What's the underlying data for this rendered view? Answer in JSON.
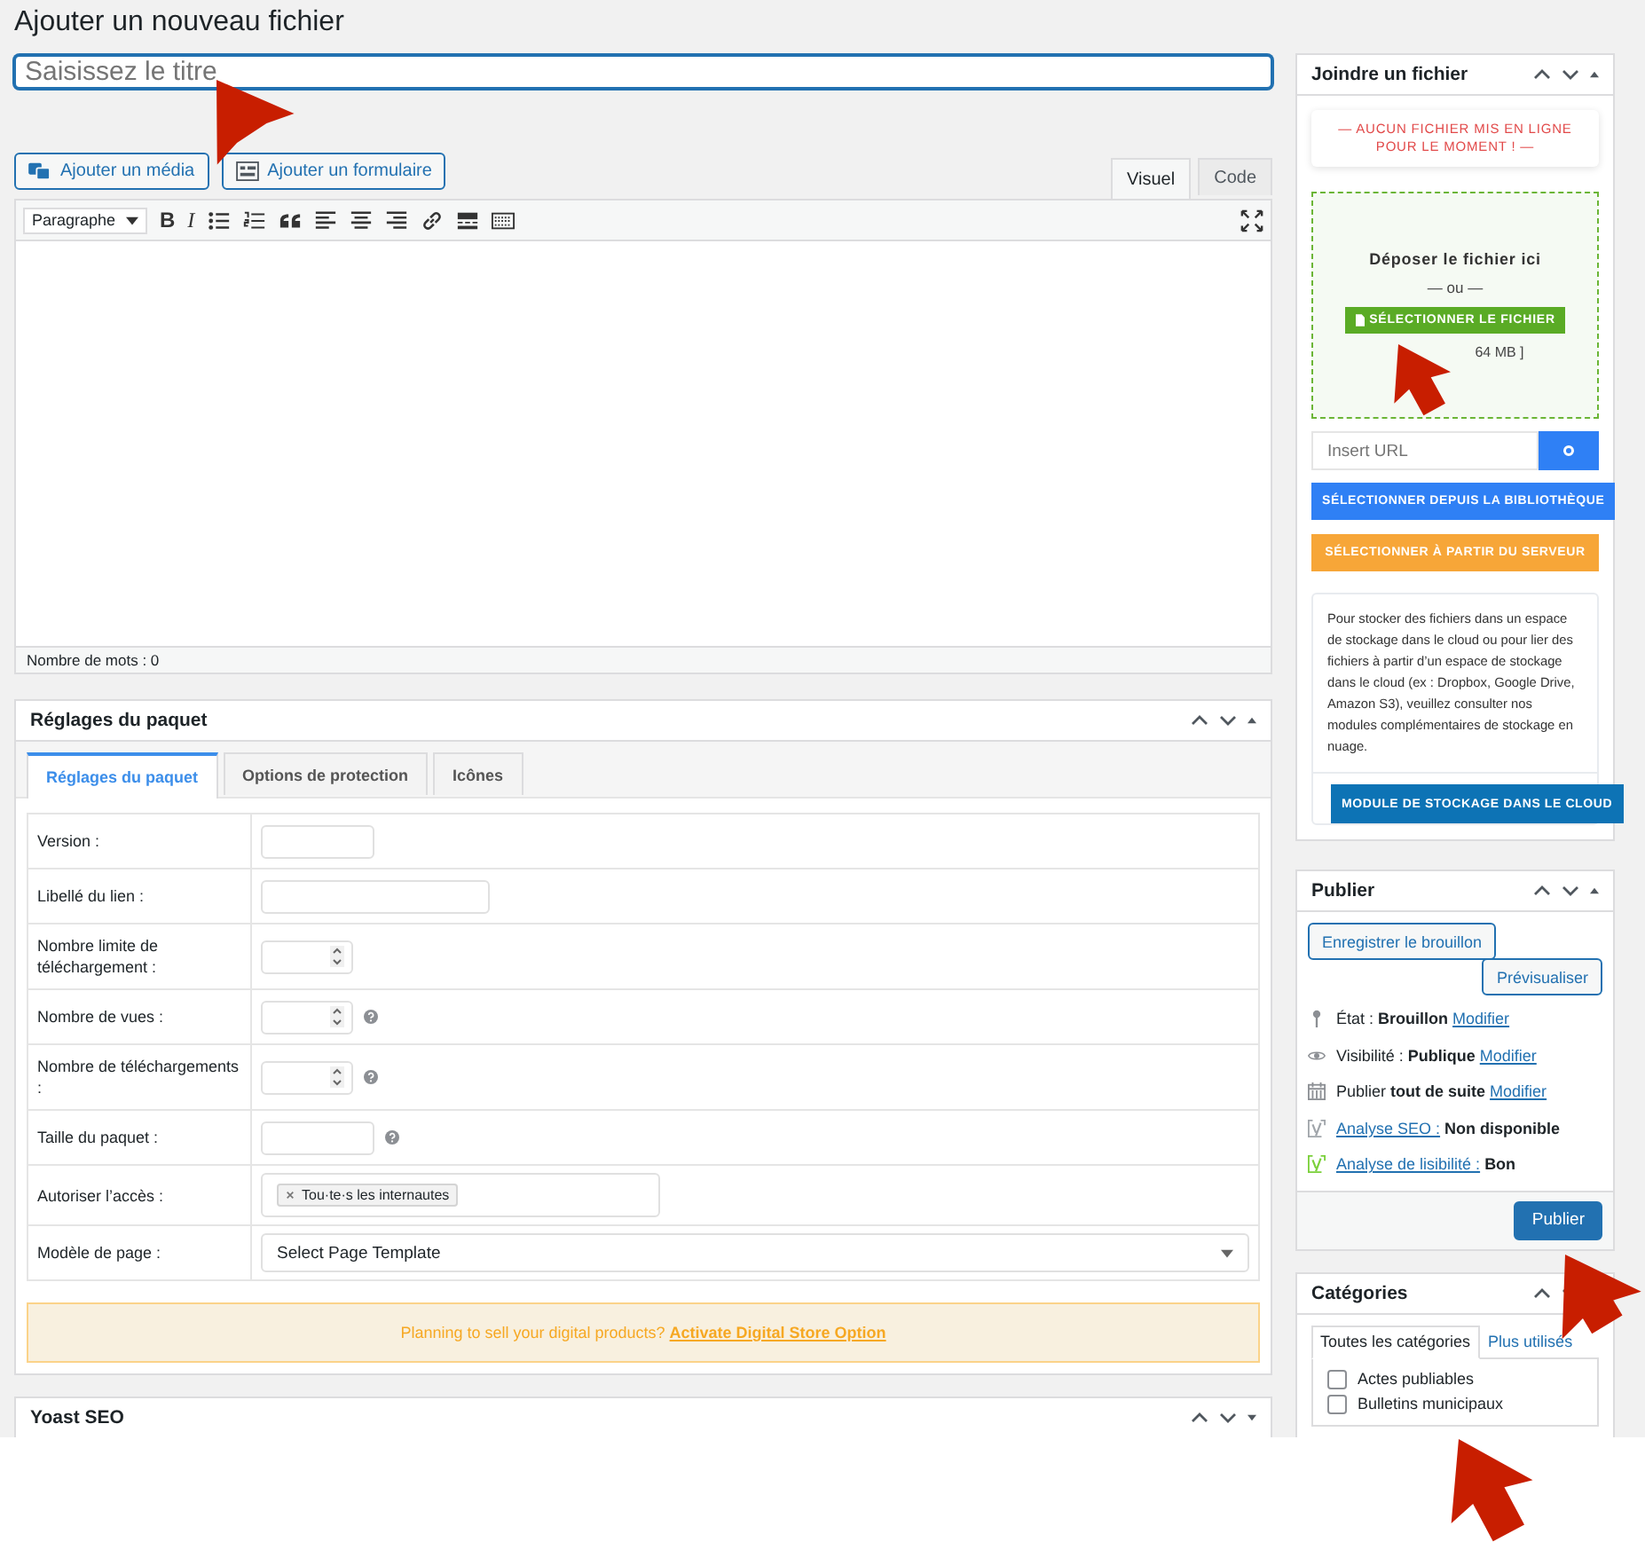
{
  "page_title": "Ajouter un nouveau fichier",
  "title_field": {
    "placeholder": "Saisissez le titre"
  },
  "media_buttons": [
    {
      "kind": "media",
      "label": "Ajouter un média"
    },
    {
      "kind": "form",
      "label": "Ajouter un formulaire"
    }
  ],
  "editor_tabs": [
    {
      "label": "Visuel",
      "selected": true
    },
    {
      "label": "Code",
      "selected": false
    }
  ],
  "format_select": "Paragraphe",
  "toolbar": [
    {
      "kind": "bold",
      "label": "B"
    },
    {
      "kind": "italic",
      "label": "I"
    },
    {
      "kind": "bullets"
    },
    {
      "kind": "numbers"
    },
    {
      "kind": "quote"
    },
    {
      "kind": "align-left"
    },
    {
      "kind": "align-center"
    },
    {
      "kind": "align-right"
    },
    {
      "kind": "link"
    },
    {
      "kind": "more"
    },
    {
      "kind": "toolbar"
    }
  ],
  "word_count": "Nombre de mots : 0",
  "package_settings": {
    "title": "Réglages du paquet",
    "tabs": [
      {
        "label": "Réglages du paquet",
        "selected": true
      },
      {
        "label": "Options de protection",
        "selected": false
      },
      {
        "label": "Icônes",
        "selected": false
      }
    ],
    "fields": [
      {
        "label": "Version :",
        "kind": "short"
      },
      {
        "label": "Libellé du lien :",
        "kind": "wide"
      },
      {
        "label": "Nombre limite de téléchargement :",
        "kind": "number"
      },
      {
        "label": "Nombre de vues :",
        "kind": "number",
        "help": true
      },
      {
        "label": "Nombre de téléchargements :",
        "kind": "number",
        "help": true
      },
      {
        "label": "Taille du paquet :",
        "kind": "short",
        "help": true
      },
      {
        "label": "Autoriser l’accès :",
        "kind": "tags",
        "tags": [
          "Tou·te·s les internautes"
        ]
      },
      {
        "label": "Modèle de page :",
        "kind": "select",
        "value": "Select Page Template"
      }
    ],
    "notice": {
      "text": "Planning to sell your digital products?",
      "link": "Activate Digital Store Option"
    }
  },
  "yoast": {
    "title": "Yoast SEO"
  },
  "attach": {
    "title": "Joindre un fichier",
    "empty_notice": "— AUCUN FICHIER MIS EN LIGNE POUR LE MOMENT ! —",
    "drop_text": "Déposer le fichier ici",
    "or": "— ou —",
    "select_button": "SÉLECTIONNER LE FICHIER",
    "size_note": "64 MB ]",
    "url_field": {
      "placeholder": "Insert URL"
    },
    "library_button": "SÉLECTIONNER DEPUIS LA BIBLIOTHÈQUE",
    "server_button": "SÉLECTIONNER À PARTIR DU SERVEUR",
    "cloud_text": "Pour stocker des fichiers dans un espace de stockage dans le cloud ou pour lier des fichiers à partir d’un espace de stockage dans le cloud (ex : Dropbox, Google Drive, Amazon S3), veuillez consulter nos modules complémentaires de stockage en nuage.",
    "cloud_button": "MODULE DE STOCKAGE DANS LE CLOUD"
  },
  "publish": {
    "title": "Publier",
    "save_draft": "Enregistrer le brouillon",
    "preview": "Prévisualiser",
    "rows": [
      {
        "before": "État : **Brouillon**",
        "link": "Modifier"
      },
      {
        "before": "Visibilité : **Publique**",
        "link": "Modifier"
      },
      {
        "before": "Publier **tout de suite**",
        "link": "Modifier"
      },
      {
        "color": "#a0a5aa",
        "link": "Analyse SEO :",
        "after": "**Non disponible**"
      },
      {
        "color": "#7ad03a",
        "link": "Analyse de lisibilité :",
        "after": "**Bon**"
      }
    ],
    "publish_button": "Publier"
  },
  "categories": {
    "title": "Catégories",
    "tabs": [
      {
        "label": "Toutes les catégories",
        "selected": true
      },
      {
        "label": "Plus utilisés",
        "selected": false
      }
    ],
    "items": [
      {
        "label": "Actes publiables",
        "checked": false
      },
      {
        "label": "Bulletins municipaux",
        "checked": false
      }
    ]
  }
}
